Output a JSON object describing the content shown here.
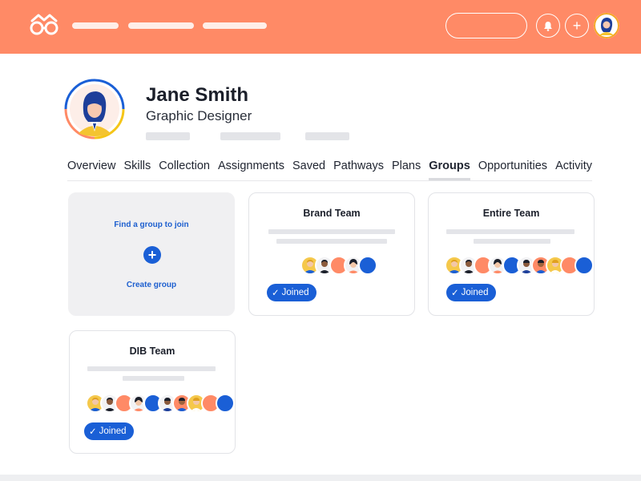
{
  "header": {
    "logo_icon": "glasses-logo-icon",
    "nav_placeholders": 3,
    "bell_icon": "bell-icon",
    "add_icon": "plus-icon",
    "add_label": "+",
    "accent_color": "#ff8a66"
  },
  "profile": {
    "name": "Jane Smith",
    "title": "Graphic Designer"
  },
  "tabs": [
    {
      "label": "Overview"
    },
    {
      "label": "Skills"
    },
    {
      "label": "Collection"
    },
    {
      "label": "Assignments"
    },
    {
      "label": "Saved"
    },
    {
      "label": "Pathways"
    },
    {
      "label": "Plans"
    },
    {
      "label": "Groups",
      "active": true
    },
    {
      "label": "Opportunities"
    },
    {
      "label": "Activity"
    }
  ],
  "find_card": {
    "find_label": "Find a group to join",
    "plus_label": "+",
    "create_label": "Create group"
  },
  "groups": [
    {
      "name": "Brand Team",
      "status": "Joined",
      "check": "✓"
    },
    {
      "name": "Entire Team",
      "status": "Joined",
      "check": "✓"
    },
    {
      "name": "DIB Team",
      "status": "Joined",
      "check": "✓"
    }
  ],
  "colors": {
    "primary": "#1a5fd6",
    "accent": "#ff8a66"
  }
}
